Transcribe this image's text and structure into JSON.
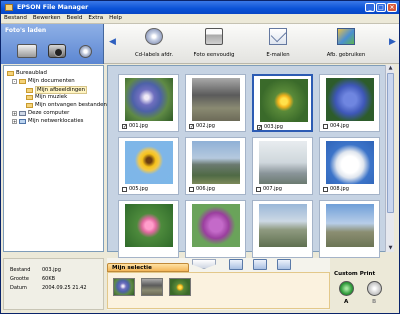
{
  "window": {
    "title": "EPSON File Manager"
  },
  "menu": [
    "Bestand",
    "Bewerken",
    "Beeld",
    "Extra",
    "Help"
  ],
  "import": {
    "title": "Foto's laden",
    "devices": [
      "scanner-icon",
      "camera-icon",
      "cd-icon"
    ]
  },
  "toolbar": {
    "buttons": [
      {
        "label": "Cd-labels afdr.",
        "icon": "cd-label-icon"
      },
      {
        "label": "Foto eenvoudig",
        "icon": "printer-icon"
      },
      {
        "label": "E-mailen",
        "icon": "email-icon"
      },
      {
        "label": "Afb. gebruiken",
        "icon": "use-image-icon"
      }
    ]
  },
  "tree": {
    "items": [
      {
        "label": "Bureaublad"
      },
      {
        "label": "Mijn documenten"
      },
      {
        "label": "Mijn afbeeldingen",
        "selected": true
      },
      {
        "label": "Mijn muziek"
      },
      {
        "label": "Mijn ontvangen bestanden"
      },
      {
        "label": "Deze computer"
      },
      {
        "label": "Mijn netwerklocaties"
      }
    ]
  },
  "thumbnails": [
    {
      "caption": "001.jpg",
      "checked": true,
      "selected": false
    },
    {
      "caption": "002.jpg",
      "checked": true,
      "selected": false
    },
    {
      "caption": "003.jpg",
      "checked": true,
      "selected": true
    },
    {
      "caption": "004.jpg",
      "checked": false,
      "selected": false
    },
    {
      "caption": "005.jpg",
      "checked": false,
      "selected": false
    },
    {
      "caption": "006.jpg",
      "checked": false,
      "selected": false
    },
    {
      "caption": "007.jpg",
      "checked": false,
      "selected": false
    },
    {
      "caption": "008.jpg",
      "checked": false,
      "selected": false
    },
    {
      "caption": "",
      "checked": false,
      "selected": false
    },
    {
      "caption": "",
      "checked": false,
      "selected": false
    },
    {
      "caption": "",
      "checked": false,
      "selected": false
    },
    {
      "caption": "",
      "checked": false,
      "selected": false
    }
  ],
  "info": {
    "rows": [
      {
        "key": "Bestand",
        "value": "003.jpg"
      },
      {
        "key": "Grootte",
        "value": "60KB"
      },
      {
        "key": "Datum",
        "value": "2004.09.25 21.42"
      }
    ]
  },
  "selection": {
    "title": "Mijn selectie"
  },
  "custom_print": {
    "title": "Custom Print",
    "buttons": [
      "A",
      "B"
    ]
  }
}
